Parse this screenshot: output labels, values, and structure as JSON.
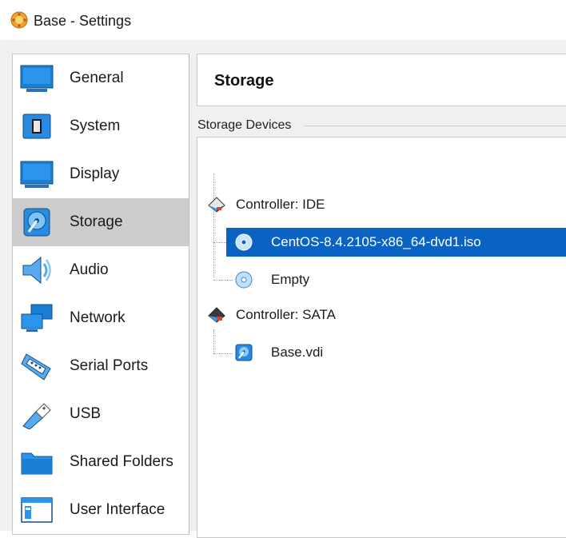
{
  "window": {
    "title": "Base - Settings"
  },
  "sidebar": {
    "items": [
      {
        "label": "General",
        "icon": "general-icon"
      },
      {
        "label": "System",
        "icon": "system-icon"
      },
      {
        "label": "Display",
        "icon": "display-icon"
      },
      {
        "label": "Storage",
        "icon": "storage-icon",
        "selected": true
      },
      {
        "label": "Audio",
        "icon": "audio-icon"
      },
      {
        "label": "Network",
        "icon": "network-icon"
      },
      {
        "label": "Serial Ports",
        "icon": "serial-ports-icon"
      },
      {
        "label": "USB",
        "icon": "usb-icon"
      },
      {
        "label": "Shared Folders",
        "icon": "shared-folders-icon"
      },
      {
        "label": "User Interface",
        "icon": "user-interface-icon"
      }
    ]
  },
  "page": {
    "title": "Storage"
  },
  "storage_devices": {
    "label": "Storage Devices",
    "controllers": [
      {
        "label": "Controller: IDE",
        "attachments": [
          {
            "label": "CentOS-8.4.2105-x86_64-dvd1.iso",
            "type": "optical",
            "selected": true
          },
          {
            "label": "Empty",
            "type": "optical"
          }
        ]
      },
      {
        "label": "Controller: SATA",
        "attachments": [
          {
            "label": "Base.vdi",
            "type": "hard-disk"
          }
        ]
      }
    ]
  },
  "colors": {
    "selection": "#0a63c4",
    "sidebar_selected": "#cccccc",
    "dialog_bg": "#f0f0f0"
  }
}
